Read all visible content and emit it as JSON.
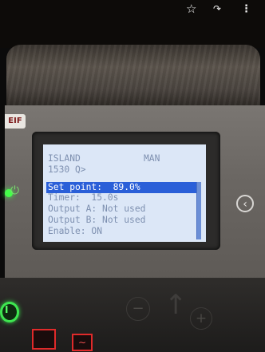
{
  "panel": {
    "brand_mark": "EIF",
    "power_icon": "power-icon",
    "right_icon": "chevron-right-icon",
    "start_icon": "power-icon",
    "gen_icon": "sine-wave-icon"
  },
  "lcd": {
    "status": "ISLAND",
    "mode": "MAN",
    "frequency": "1530 Q>",
    "menu": [
      {
        "label": "Set point:",
        "value": "89.0%",
        "text": "Set point:  89.0%"
      },
      {
        "label": "Timer:",
        "value": "15.0s",
        "text": "Timer:  15.0s"
      },
      {
        "label": "Output A:",
        "value": "Not used",
        "text": "Output A: Not used"
      },
      {
        "label": "Output B:",
        "value": "Not used",
        "text": "Output B: Not used"
      },
      {
        "label": "Enable:",
        "value": "ON",
        "text": "Enable: ON"
      }
    ]
  },
  "keypad": {
    "minus_glyph": "−",
    "up_glyph": "↑",
    "plus_glyph": "+"
  },
  "browser": {
    "bookmark_icon": "star-icon",
    "share_icon": "share-icon",
    "more_icon": "more-vertical-icon"
  },
  "colors": {
    "lcd_background": "#dce7f7",
    "lcd_highlight": "#2a5fd8",
    "led_green": "#45ff4a",
    "button_red": "#e02a2a"
  }
}
